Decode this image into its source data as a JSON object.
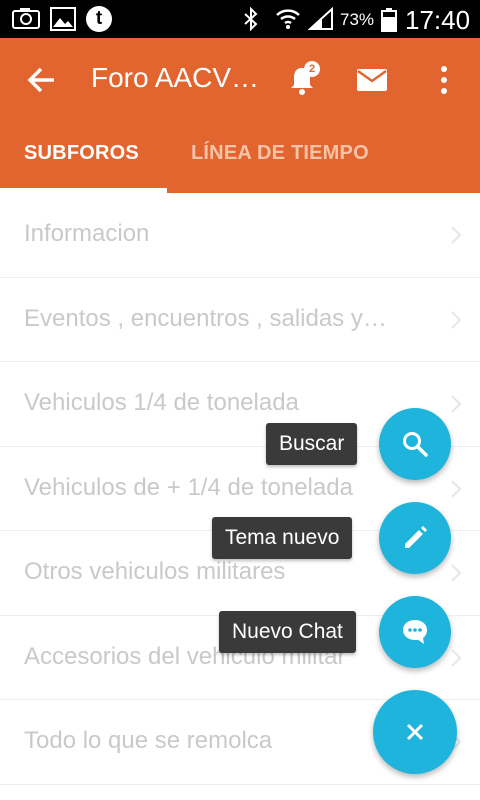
{
  "status_bar": {
    "notification_icons": [
      "camera-icon",
      "gallery-icon",
      "tumblr-icon"
    ],
    "tumblr_glyph": "t",
    "battery_percent": "73%",
    "time": "17:40"
  },
  "app_bar": {
    "title": "Foro AACV…",
    "notification_count": "2",
    "color": "#e26530"
  },
  "tabs": [
    {
      "label": "SUBFOROS",
      "selected": true
    },
    {
      "label": "LÍNEA DE TIEMPO",
      "selected": false
    }
  ],
  "list": {
    "items": [
      {
        "label": "Informacion"
      },
      {
        "label": "Eventos , encuentros , salidas y…"
      },
      {
        "label": "Vehiculos 1/4 de tonelada"
      },
      {
        "label": "Vehiculos de + 1/4 de tonelada"
      },
      {
        "label": "Otros vehiculos militares"
      },
      {
        "label": "Accesorios del vehiculo militar"
      },
      {
        "label": "Todo lo que se remolca"
      }
    ]
  },
  "fab_menu": {
    "accent": "#1fb4db",
    "actions": [
      {
        "label": "Buscar",
        "icon": "search-icon"
      },
      {
        "label": "Tema nuevo",
        "icon": "pencil-icon"
      },
      {
        "label": "Nuevo Chat",
        "icon": "chat-icon"
      }
    ],
    "close_icon": "close-icon"
  }
}
